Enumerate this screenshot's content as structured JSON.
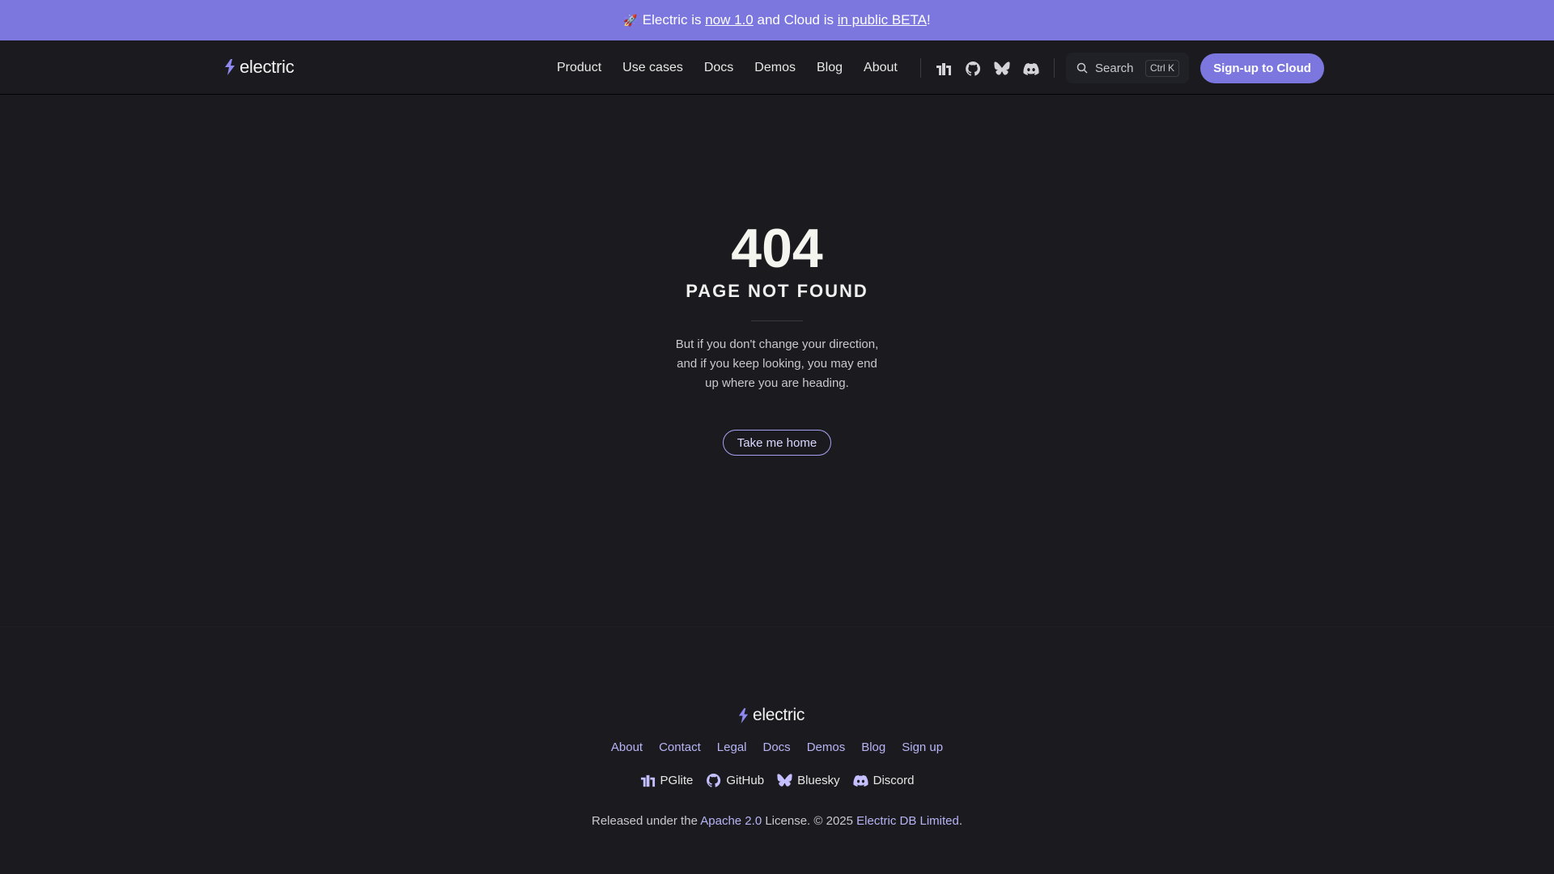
{
  "banner": {
    "emoji": "🚀",
    "text1": "Electric is ",
    "link1": "now 1.0",
    "text2": " and Cloud is ",
    "link2": "in public BETA",
    "text3": "!"
  },
  "nav": {
    "logo_text": "electric",
    "links": [
      "Product",
      "Use cases",
      "Docs",
      "Demos",
      "Blog",
      "About"
    ],
    "icons": [
      "pglite-icon",
      "github-icon",
      "bluesky-icon",
      "discord-icon"
    ],
    "search_label": "Search",
    "search_shortcut": "Ctrl K",
    "cta_label": "Sign-up to Cloud"
  },
  "main": {
    "code": "404",
    "title": "PAGE NOT FOUND",
    "quote": "But if you don't change your direction, and if you keep looking, you may end up where you are heading.",
    "home_button": "Take me home"
  },
  "footer": {
    "logo_text": "electric",
    "links": [
      "About",
      "Contact",
      "Legal",
      "Docs",
      "Demos",
      "Blog",
      "Sign up"
    ],
    "social": [
      "PGlite",
      "GitHub",
      "Bluesky",
      "Discord"
    ],
    "license_prefix": "Released under the ",
    "license_link": "Apache 2.0",
    "license_mid": " License. © 2025 ",
    "company_link": "Electric DB Limited",
    "license_suffix": "."
  },
  "colors": {
    "accent": "#7b77df",
    "background": "#1b1b1f",
    "link": "#b7b4f5"
  }
}
